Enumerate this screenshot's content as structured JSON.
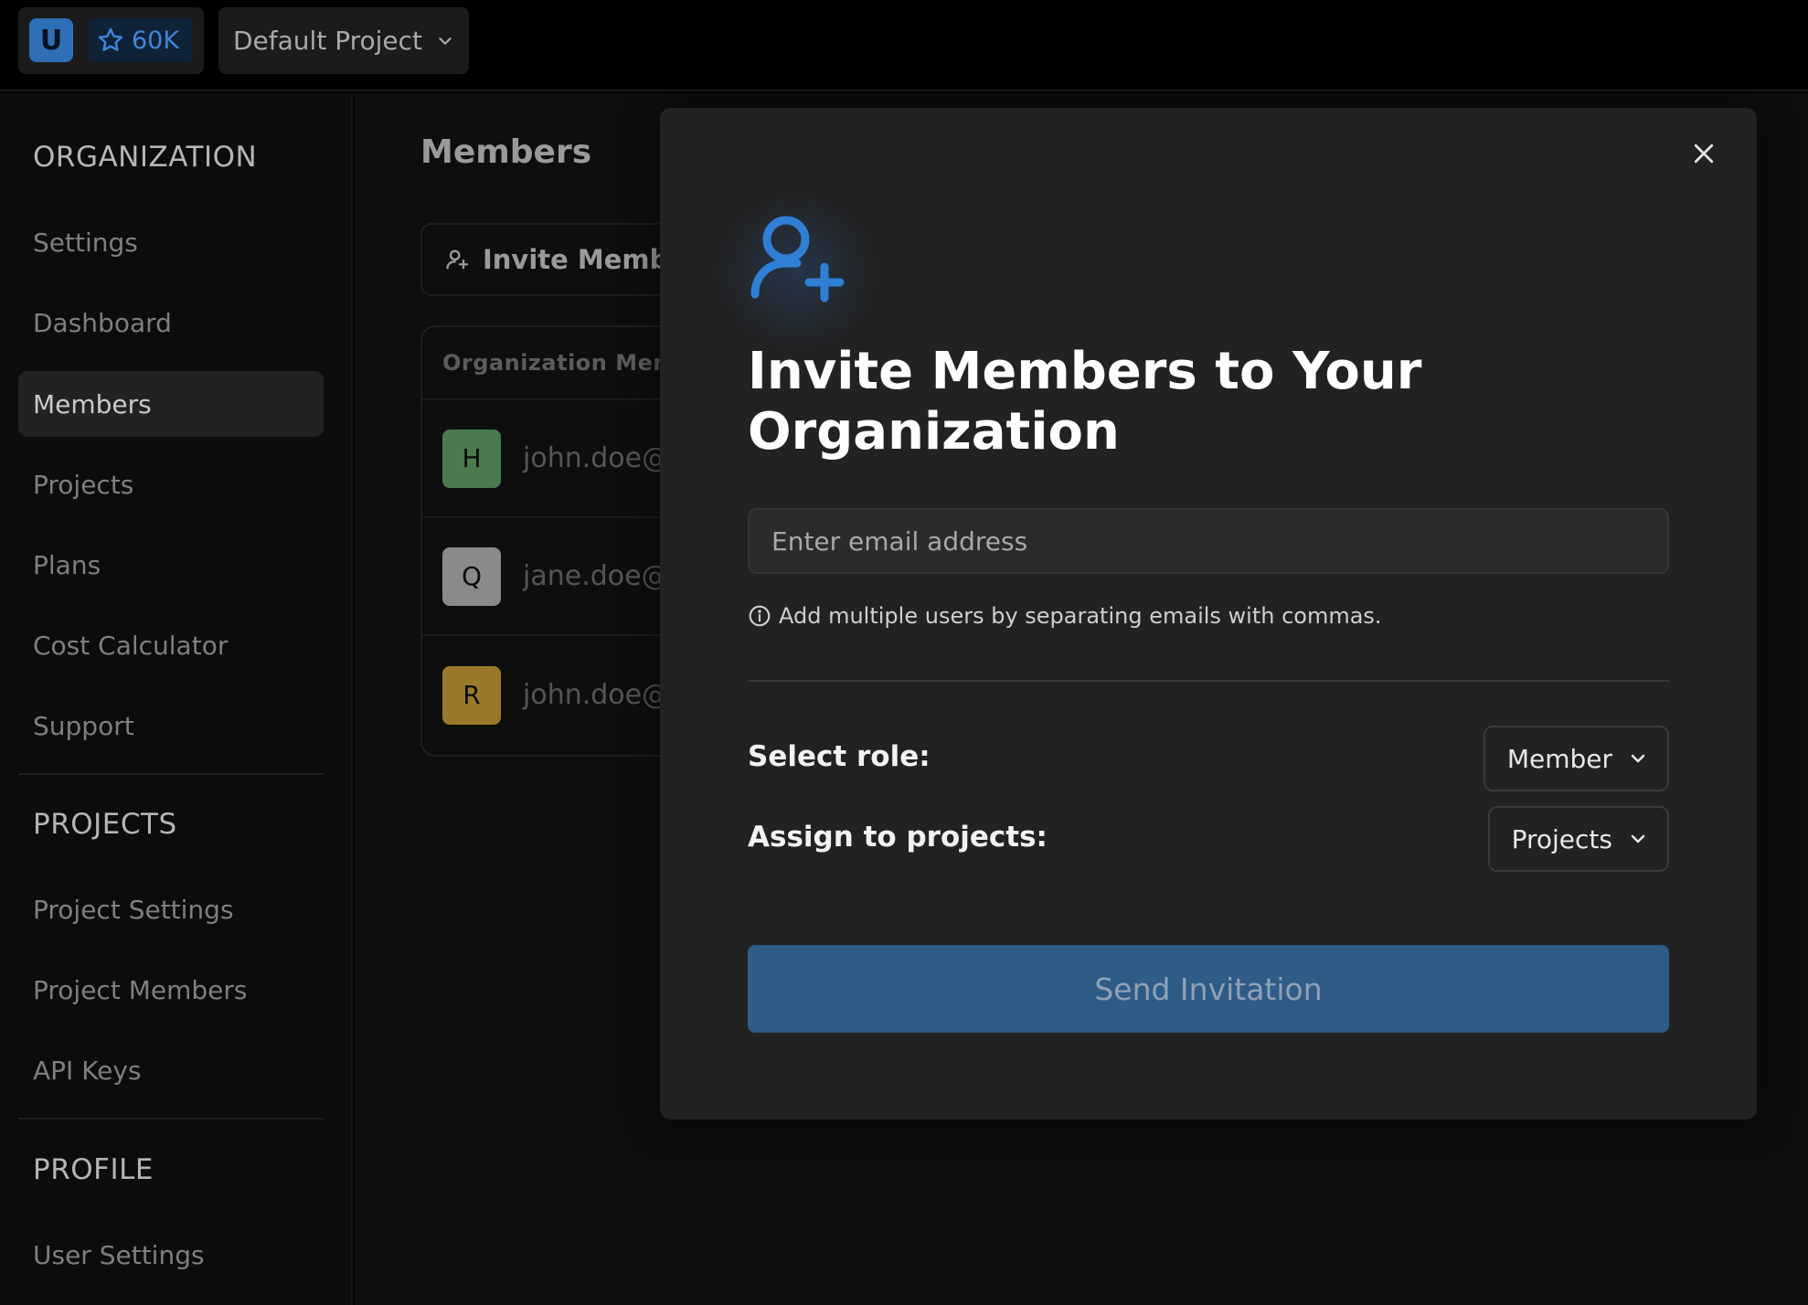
{
  "topbar": {
    "brand_letter": "U",
    "stars_count": "60K",
    "project_name": "Default Project"
  },
  "sidebar": {
    "sections": [
      {
        "title": "ORGANIZATION",
        "items": [
          {
            "label": "Settings"
          },
          {
            "label": "Dashboard"
          },
          {
            "label": "Members",
            "active": true
          },
          {
            "label": "Projects"
          },
          {
            "label": "Plans"
          },
          {
            "label": "Cost Calculator"
          },
          {
            "label": "Support"
          }
        ]
      },
      {
        "title": "PROJECTS",
        "items": [
          {
            "label": "Project Settings"
          },
          {
            "label": "Project Members"
          },
          {
            "label": "API Keys"
          }
        ]
      },
      {
        "title": "PROFILE",
        "items": [
          {
            "label": "User Settings"
          }
        ]
      }
    ]
  },
  "main": {
    "title": "Members",
    "invite_button": "Invite Membe",
    "table_header": "Organization Mem",
    "rows": [
      {
        "initial": "H",
        "email": "john.doe@",
        "color": "#4a7a4f"
      },
      {
        "initial": "Q",
        "email": "jane.doe@",
        "color": "#8a8a8a"
      },
      {
        "initial": "R",
        "email": "john.doe@",
        "color": "#9a7a2a"
      }
    ]
  },
  "modal": {
    "title": "Invite Members to Your Organization",
    "email_placeholder": "Enter email address",
    "hint": "Add multiple users by separating emails with commas.",
    "role_label": "Select role:",
    "role_value": "Member",
    "projects_label": "Assign to projects:",
    "projects_value": "Projects",
    "send_button": "Send Invitation"
  },
  "colors": {
    "accent": "#3f86d8",
    "send_button_bg": "#2f5b87",
    "modal_bg": "#222222"
  }
}
